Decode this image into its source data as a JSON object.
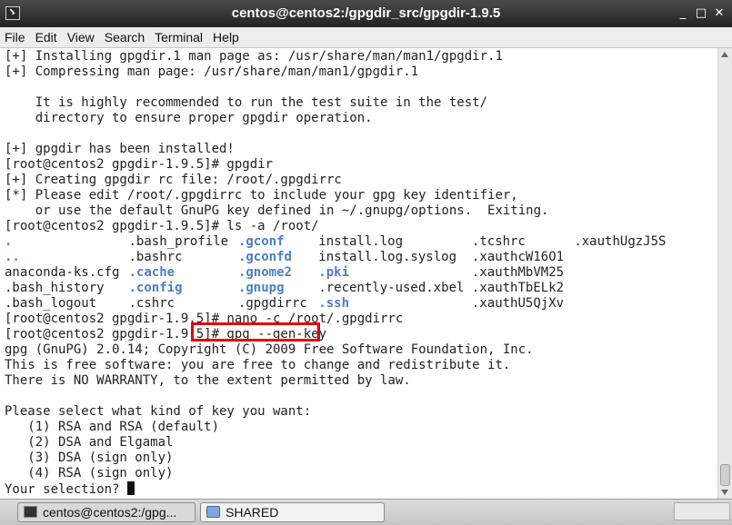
{
  "window": {
    "title": "centos@centos2:/gpgdir_src/gpgdir-1.9.5",
    "minimize_glyph": "_",
    "maximize_glyph": "□",
    "close_glyph": "✕"
  },
  "menu": [
    "File",
    "Edit",
    "View",
    "Search",
    "Terminal",
    "Help"
  ],
  "terminal": {
    "lines": [
      "[+] Installing gpgdir.1 man page as: /usr/share/man/man1/gpgdir.1",
      "[+] Compressing man page: /usr/share/man/man1/gpgdir.1",
      "",
      "    It is highly recommended to run the test suite in the test/",
      "    directory to ensure proper gpgdir operation.",
      "",
      "[+] gpgdir has been installed!",
      "[root@centos2 gpgdir-1.9.5]# gpgdir",
      "[+] Creating gpgdir rc file: /root/.gpgdirrc",
      "[*] Please edit /root/.gpgdirrc to include your gpg key identifier,",
      "    or use the default GnuPG key defined in ~/.gnupg/options.  Exiting.",
      "[root@centos2 gpgdir-1.9.5]# ls -a /root/"
    ],
    "ls_rows": [
      [
        ".",
        ".bash_profile",
        ".gconf",
        "install.log",
        ".tcshrc",
        ".xauthUgzJ5S"
      ],
      [
        "..",
        ".bashrc",
        ".gconfd",
        "install.log.syslog",
        ".xauthcW16O1",
        ""
      ],
      [
        "anaconda-ks.cfg",
        ".cache",
        ".gnome2",
        ".pki",
        ".xauthMbVM25",
        ""
      ],
      [
        ".bash_history",
        ".config",
        ".gnupg",
        ".recently-used.xbel",
        ".xauthTbELk2",
        ""
      ],
      [
        ".bash_logout",
        ".cshrc",
        ".gpgdirrc",
        ".ssh",
        ".xauthU5QjXv",
        ""
      ]
    ],
    "ls_blue": [
      [
        true,
        false,
        true,
        false,
        false,
        false
      ],
      [
        true,
        false,
        true,
        false,
        false,
        false
      ],
      [
        false,
        true,
        true,
        true,
        false,
        false
      ],
      [
        false,
        true,
        true,
        false,
        false,
        false
      ],
      [
        false,
        false,
        false,
        true,
        false,
        false
      ]
    ],
    "after_lines": [
      "[root@centos2 gpgdir-1.9.5]# nano -c /root/.gpgdirrc",
      "[root@centos2 gpgdir-1.9.5]# gpg --gen-key",
      "gpg (GnuPG) 2.0.14; Copyright (C) 2009 Free Software Foundation, Inc.",
      "This is free software: you are free to change and redistribute it.",
      "There is NO WARRANTY, to the extent permitted by law.",
      "",
      "Please select what kind of key you want:",
      "   (1) RSA and RSA (default)",
      "   (2) DSA and Elgamal",
      "   (3) DSA (sign only)",
      "   (4) RSA (sign only)"
    ],
    "prompt": "Your selection? ",
    "highlight_color": "#e60000",
    "dir_color": "#4b7fc4"
  },
  "taskbar": {
    "items": [
      {
        "label": "centos@centos2:/gpg...",
        "icon": "terminal-icon"
      },
      {
        "label": "SHARED",
        "icon": "folder-icon"
      }
    ]
  }
}
